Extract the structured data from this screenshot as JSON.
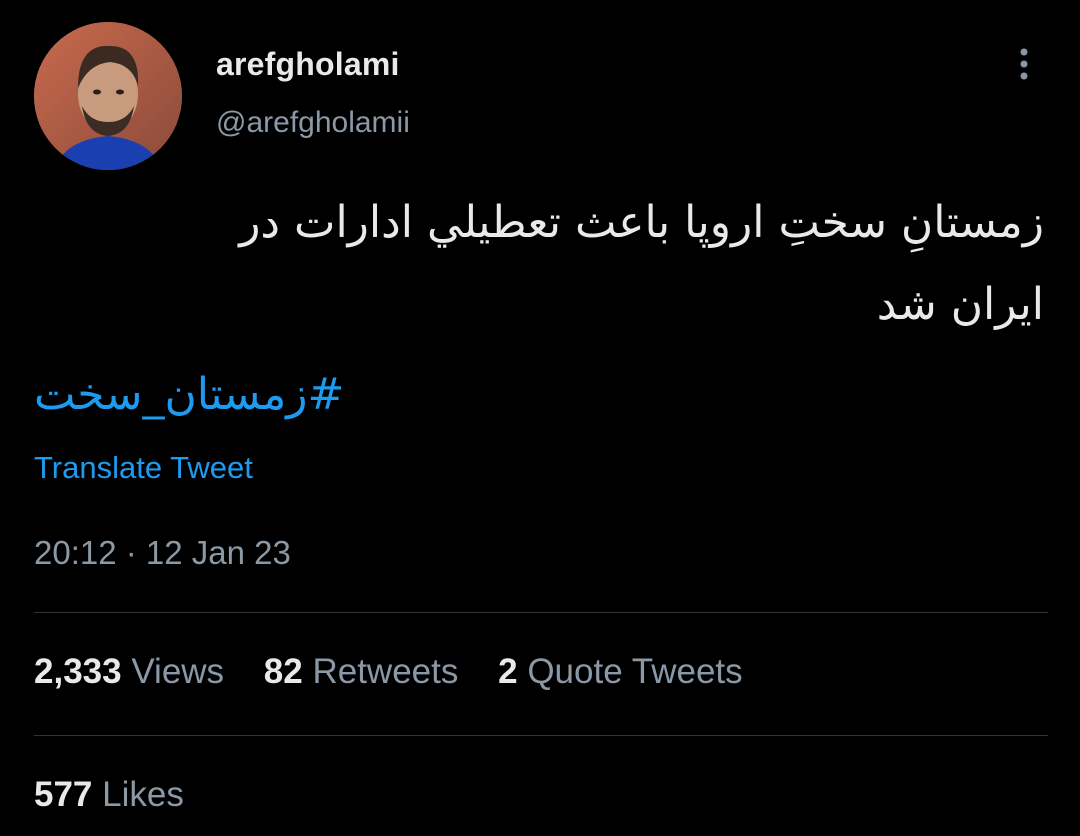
{
  "user": {
    "display_name": "arefgholami",
    "handle": "@arefgholamii"
  },
  "tweet": {
    "text_line1": "زمستانِ سختِ اروپا باعث تعطیلي ادارات در",
    "text_line2": "ایران شد",
    "hashtag": "#زمستان_سخت",
    "translate_label": "Translate Tweet",
    "timestamp": "20:12 · 12 Jan 23"
  },
  "stats": {
    "views_count": "2,333",
    "views_label": "Views",
    "retweets_count": "82",
    "retweets_label": "Retweets",
    "quotes_count": "2",
    "quotes_label": "Quote Tweets",
    "likes_count": "577",
    "likes_label": "Likes"
  },
  "colors": {
    "background": "#000000",
    "link": "#1d9bf0",
    "primary_text": "#e7e9ea",
    "secondary_text": "#8b98a5",
    "divider": "#2f3336"
  },
  "icons": {
    "more": "more-vertical-icon"
  }
}
